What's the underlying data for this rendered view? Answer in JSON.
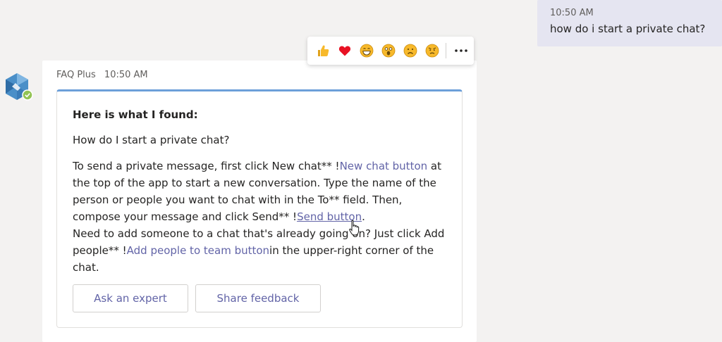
{
  "user_message": {
    "time": "10:50 AM",
    "text": "how do i start a private chat?"
  },
  "reactions": [
    {
      "name": "like",
      "icon": "thumbs-up-icon"
    },
    {
      "name": "heart",
      "icon": "heart-icon"
    },
    {
      "name": "laugh",
      "icon": "laugh-icon"
    },
    {
      "name": "surprised",
      "icon": "surprised-icon"
    },
    {
      "name": "sad",
      "icon": "sad-icon"
    },
    {
      "name": "angry",
      "icon": "angry-icon"
    }
  ],
  "more_options_icon": "more-options-icon",
  "bot_message": {
    "sender": "FAQ Plus",
    "time": "10:50 AM",
    "card": {
      "title": "Here is what I found:",
      "question": "How do I start a private chat?",
      "answer": {
        "p1": "To send a private message, first click New chat** !",
        "link1": "New chat button",
        "p2": " at the top of the app to start a new conversation. Type the name of the person or people you want to chat with in the To** field. Then, compose your message and click Send** !",
        "link2": "Send button",
        "p3": ".",
        "p4": "Need to add someone to a chat that's already going on? Just click Add people** !",
        "link3": "Add people to team button",
        "p5": "in the upper-right corner of the chat."
      },
      "buttons": {
        "ask_expert": "Ask an expert",
        "share_feedback": "Share feedback"
      }
    }
  },
  "colors": {
    "background": "#f3f2f1",
    "user_bubble": "#e5e5f1",
    "accent": "#6264a7",
    "card_top_border": "#6c9fd9",
    "reaction_yellow": "#f7b92b",
    "heart_red": "#e81123"
  }
}
